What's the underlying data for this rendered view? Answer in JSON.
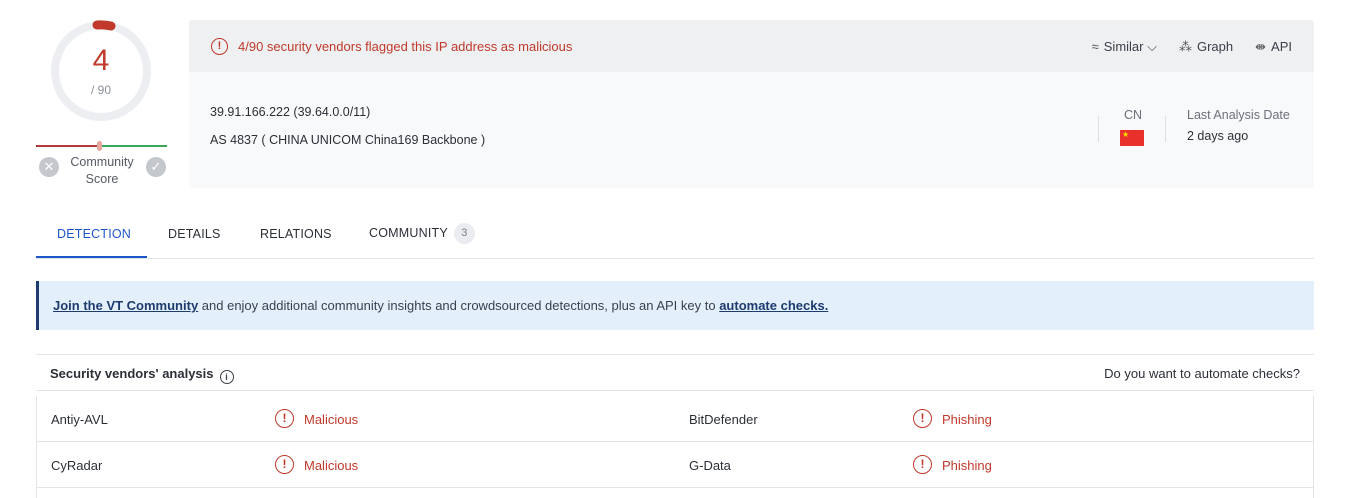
{
  "score": {
    "detections": "4",
    "total": "/ 90",
    "fraction": 0.044
  },
  "community": {
    "label_line1": "Community",
    "label_line2": "Score"
  },
  "alert": {
    "text": "4/90 security vendors flagged this IP address as malicious"
  },
  "actions": {
    "similar": "Similar",
    "graph": "Graph",
    "api": "API"
  },
  "ip": {
    "address": "39.91.166.222  (39.64.0.0/11)",
    "asn": "AS 4837  ( CHINA UNICOM China169 Backbone )"
  },
  "country": {
    "code": "CN"
  },
  "last_analysis": {
    "label": "Last Analysis Date",
    "value": "2 days ago"
  },
  "tabs": [
    {
      "label": "DETECTION"
    },
    {
      "label": "DETAILS"
    },
    {
      "label": "RELATIONS"
    },
    {
      "label": "COMMUNITY",
      "badge": "3"
    }
  ],
  "banner": {
    "link1": "Join the VT Community",
    "middle": " and enjoy additional community insights and crowdsourced detections, plus an API key to ",
    "link2": "automate checks."
  },
  "vendors": {
    "title": "Security vendors' analysis",
    "automate": "Do you want to automate checks?",
    "rows": [
      {
        "left_name": "Antiy-AVL",
        "left_result": "Malicious",
        "right_name": "BitDefender",
        "right_result": "Phishing"
      },
      {
        "left_name": "CyRadar",
        "left_result": "Malicious",
        "right_name": "G-Data",
        "right_result": "Phishing"
      }
    ]
  },
  "colors": {
    "malicious": "#c0392b",
    "accent": "#1e56c8",
    "banner_bg": "#e3f0fb"
  }
}
